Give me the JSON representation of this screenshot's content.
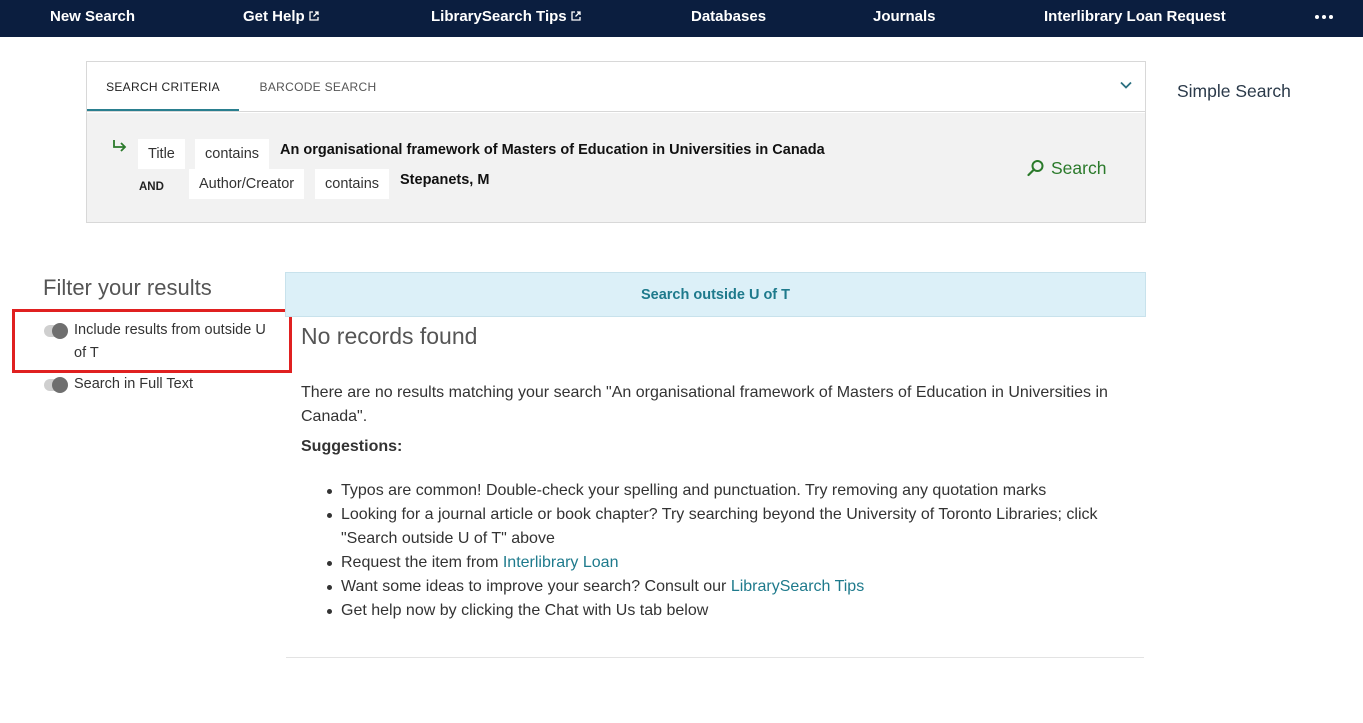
{
  "nav": {
    "items": [
      {
        "label": "New Search",
        "external": false
      },
      {
        "label": "Get Help",
        "external": true
      },
      {
        "label": "LibrarySearch Tips",
        "external": true
      },
      {
        "label": "Databases",
        "external": false
      },
      {
        "label": "Journals",
        "external": false
      },
      {
        "label": "Interlibrary Loan Request",
        "external": false
      }
    ],
    "more_icon": "more-horizontal-icon"
  },
  "search_panel": {
    "tabs": [
      {
        "label": "SEARCH CRITERIA",
        "active": true
      },
      {
        "label": "BARCODE SEARCH",
        "active": false
      }
    ],
    "rows": [
      {
        "operator": "",
        "field": "Title",
        "condition": "contains",
        "term": "An organisational framework of Masters of Education in Universities in Canada"
      },
      {
        "operator": "AND",
        "field": "Author/Creator",
        "condition": "contains",
        "term": "Stepanets, M"
      }
    ],
    "search_label": "Search"
  },
  "simple_search_label": "Simple Search",
  "filters": {
    "title": "Filter your results",
    "toggles": [
      {
        "label": "Include results from outside U of T",
        "on": false
      },
      {
        "label": "Search in Full Text",
        "on": false
      }
    ]
  },
  "results": {
    "banner_label": "Search outside U of T",
    "no_records": "No records found",
    "message": "There are no results matching your search \"An organisational framework of Masters of Education in Universities in Canada\".",
    "suggestions_title": "Suggestions:",
    "suggestions": [
      {
        "text": "Typos are common! Double-check your spelling and punctuation. Try removing any quotation marks"
      },
      {
        "text": "Looking for a journal article or book chapter? Try searching beyond the University of Toronto Libraries; click \"Search outside U of T\" above"
      },
      {
        "prefix": "Request the item from ",
        "link": "Interlibrary Loan"
      },
      {
        "prefix": "Want some ideas to improve your search? Consult our ",
        "link": "LibrarySearch Tips"
      },
      {
        "text": "Get help now by clicking the Chat with Us tab below"
      }
    ]
  },
  "colors": {
    "nav_bg": "#0b1e3f",
    "accent_teal": "#1e7a8c",
    "search_green": "#2b7a2b",
    "highlight_red": "#e02020",
    "banner_bg": "#dcf0f8"
  }
}
